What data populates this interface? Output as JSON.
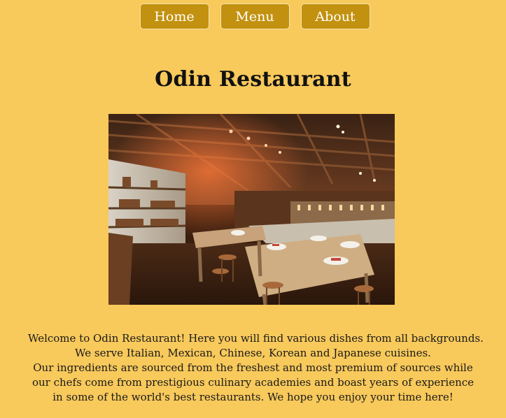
{
  "nav": {
    "items": [
      {
        "label": "Home"
      },
      {
        "label": "Menu"
      },
      {
        "label": "About"
      }
    ]
  },
  "main": {
    "title": "Odin Restaurant",
    "intro_lines": [
      "Welcome to Odin Restaurant! Here you will find various dishes from all backgrounds.",
      "We serve Italian, Mexican, Chinese, Korean and Japanese cuisines.",
      "Our ingredients are sourced from the freshest and most premium of sources while",
      "our chefs come from prestigious culinary academies and boast years of experience",
      "in some of the world's best restaurants. We hope you enjoy your time here!"
    ]
  },
  "colors": {
    "background": "#f8c95b",
    "button": "#c2910f",
    "button_border": "#f4e4b0"
  }
}
